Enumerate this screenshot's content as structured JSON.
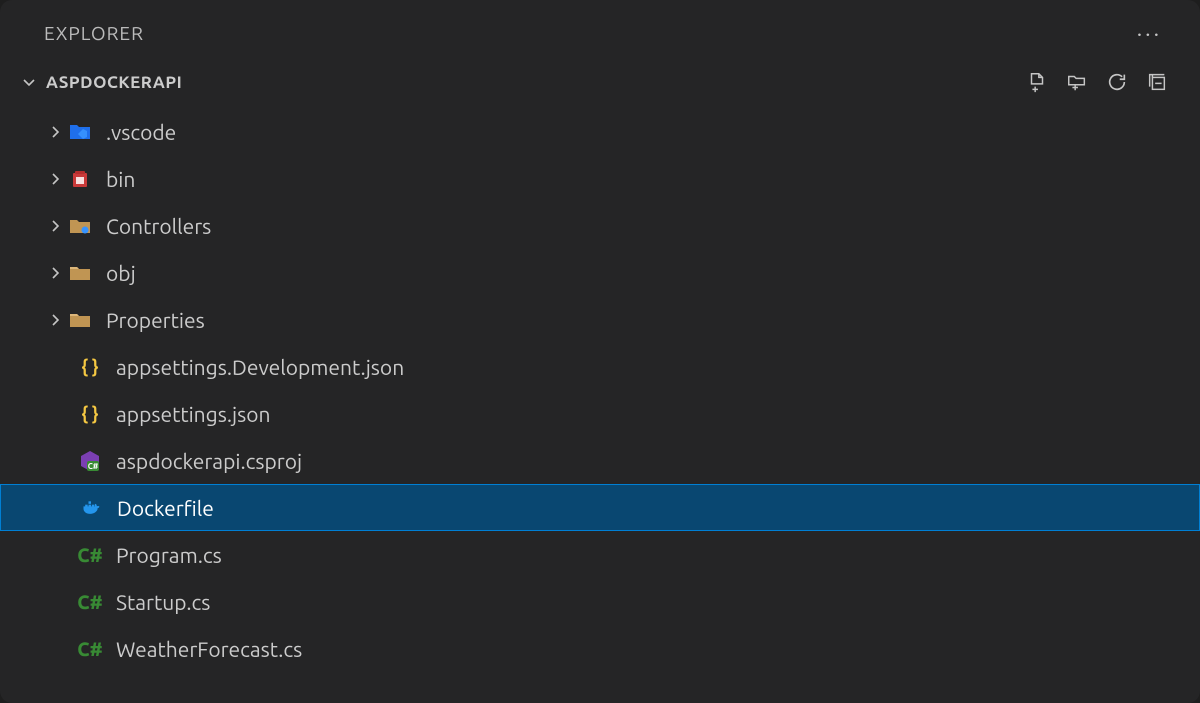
{
  "explorer": {
    "title": "EXPLORER",
    "project": "ASPDOCKERAPI",
    "toolbar": {
      "newFile": "New File",
      "newFolder": "New Folder",
      "refresh": "Refresh",
      "collapse": "Collapse All"
    },
    "items": [
      {
        "name": ".vscode",
        "type": "folder",
        "icon": "vscode-folder"
      },
      {
        "name": "bin",
        "type": "folder",
        "icon": "bin-folder"
      },
      {
        "name": "Controllers",
        "type": "folder",
        "icon": "controllers-folder"
      },
      {
        "name": "obj",
        "type": "folder",
        "icon": "generic-folder"
      },
      {
        "name": "Properties",
        "type": "folder",
        "icon": "generic-folder"
      },
      {
        "name": "appsettings.Development.json",
        "type": "file",
        "icon": "json-file"
      },
      {
        "name": "appsettings.json",
        "type": "file",
        "icon": "json-file"
      },
      {
        "name": "aspdockerapi.csproj",
        "type": "file",
        "icon": "csproj-file"
      },
      {
        "name": "Dockerfile",
        "type": "file",
        "icon": "docker-file",
        "selected": true
      },
      {
        "name": "Program.cs",
        "type": "file",
        "icon": "cs-file"
      },
      {
        "name": "Startup.cs",
        "type": "file",
        "icon": "cs-file"
      },
      {
        "name": "WeatherForecast.cs",
        "type": "file",
        "icon": "cs-file"
      }
    ]
  }
}
